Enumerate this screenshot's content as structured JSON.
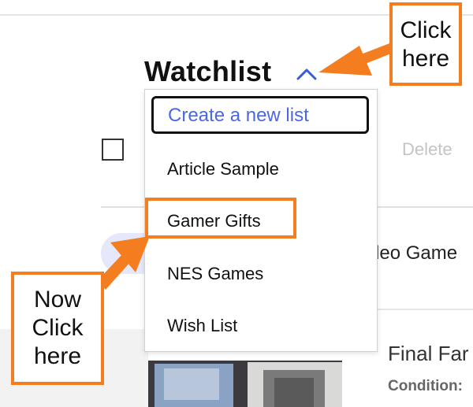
{
  "header": {
    "title": "Watchlist"
  },
  "toolbar": {
    "delete_label": "Delete"
  },
  "dropdown": {
    "create_label": "Create a new list",
    "items": [
      "Article Sample",
      "Gamer Gifts",
      "NES Games",
      "Wish List"
    ]
  },
  "filter_chip": {
    "label": "deo Game"
  },
  "item": {
    "title": "Final Far",
    "condition_label": "Condition:"
  },
  "callouts": {
    "top": [
      "Click",
      "here"
    ],
    "left": [
      "Now",
      "Click",
      "here"
    ]
  },
  "colors": {
    "highlight": "#f47d20",
    "link": "#4a67e6"
  }
}
